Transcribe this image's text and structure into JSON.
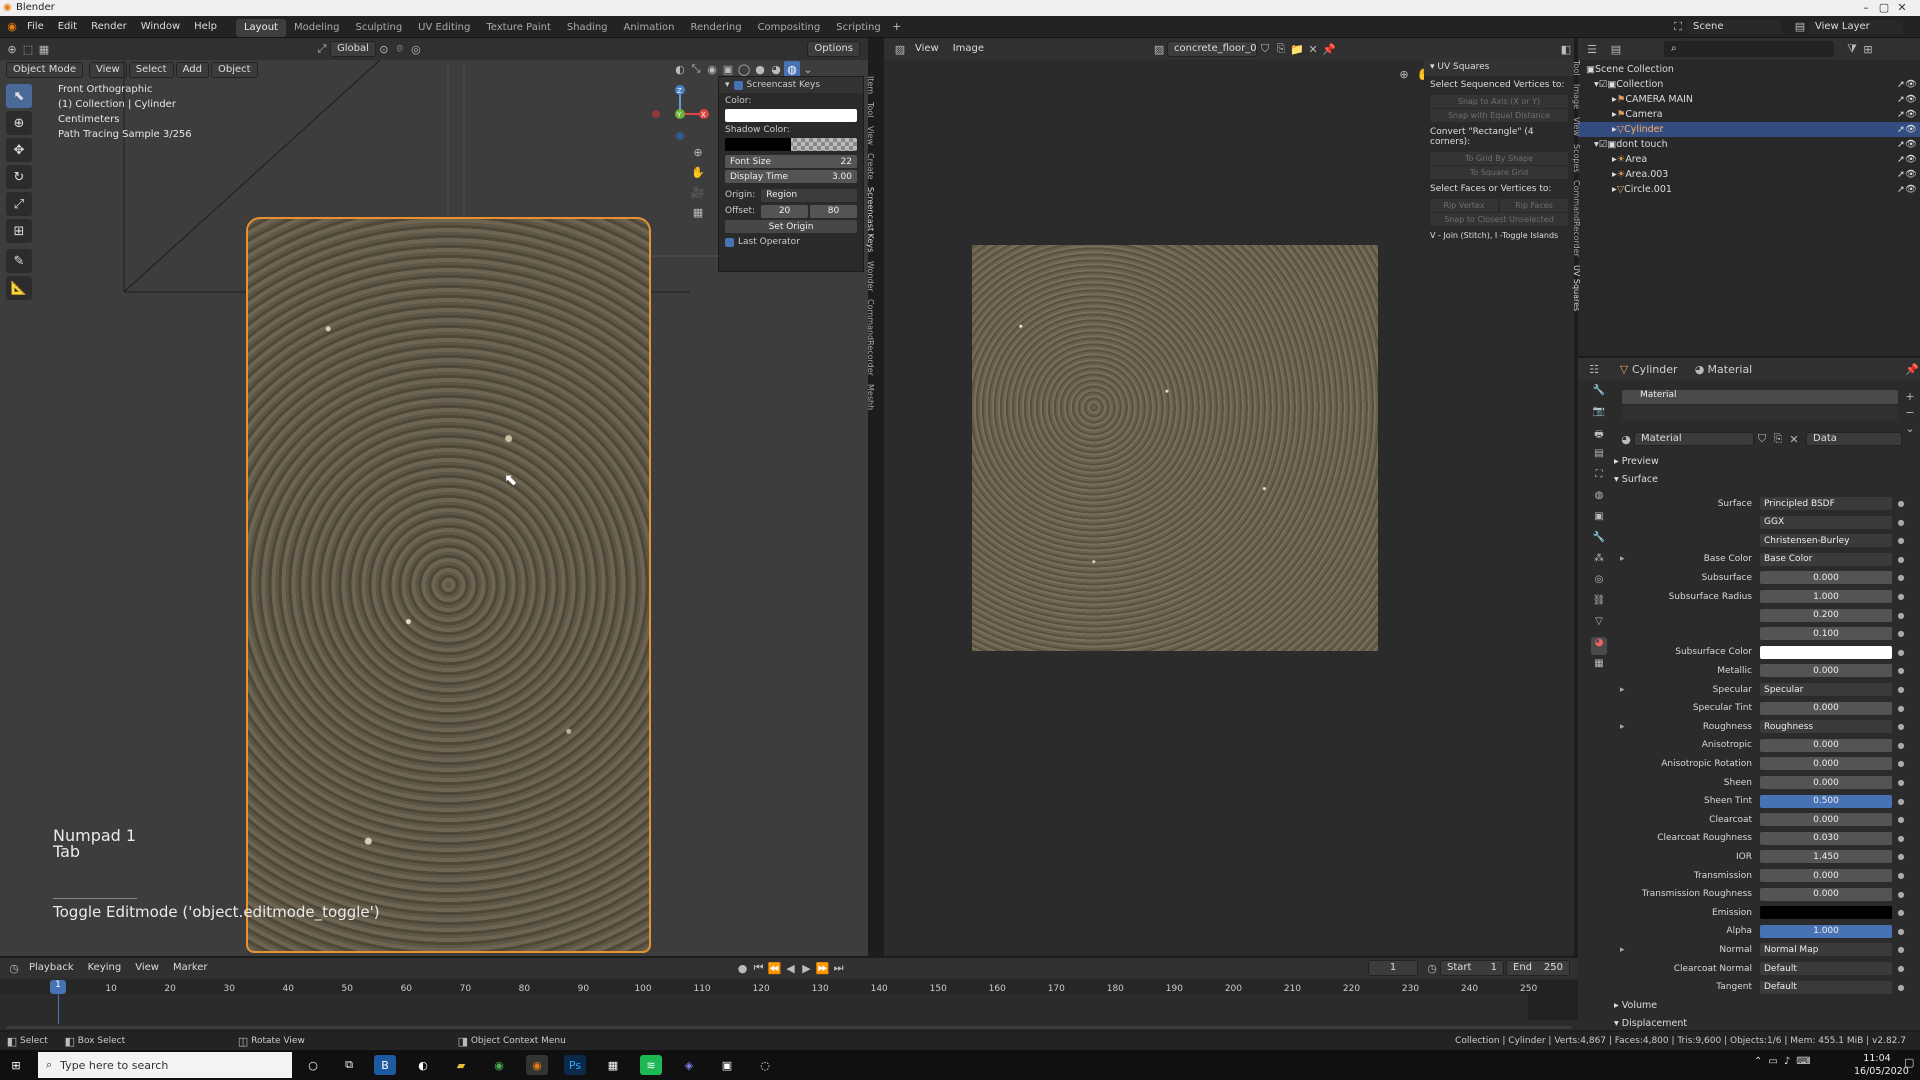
{
  "window": {
    "title": "Blender"
  },
  "menus": [
    "File",
    "Edit",
    "Render",
    "Window",
    "Help"
  ],
  "workspaces": [
    "Layout",
    "Modeling",
    "Sculpting",
    "UV Editing",
    "Texture Paint",
    "Shading",
    "Animation",
    "Rendering",
    "Compositing",
    "Scripting"
  ],
  "active_workspace": "Layout",
  "topbar_right": {
    "scene_label": "Scene",
    "view_layer_label": "View Layer"
  },
  "viewport": {
    "mode": "Object Mode",
    "menus": [
      "View",
      "Select",
      "Add",
      "Object"
    ],
    "transform": "Global",
    "options_label": "Options",
    "info_lines": [
      "Front Orthographic",
      "(1) Collection | Cylinder",
      "Centimeters",
      "Path Tracing Sample 3/256"
    ],
    "key_overlay_1": "Numpad 1",
    "key_overlay_2": "Tab",
    "operator_overlay": "Toggle Editmode ('object.editmode_toggle')"
  },
  "screencast": {
    "title": "Screencast Keys",
    "color_label": "Color:",
    "shadow_label": "Shadow Color:",
    "font_size_label": "Font Size",
    "font_size": "22",
    "display_time_label": "Display Time",
    "display_time": "3.00",
    "origin_label": "Origin:",
    "origin_value": "Region",
    "offset_label": "Offset:",
    "offset_x": "20",
    "offset_y": "80",
    "set_origin": "Set Origin",
    "last_operator": "Last Operator"
  },
  "vertical_tabs": [
    "Item",
    "Tool",
    "View",
    "Create",
    "Screencast Keys",
    "Wonder",
    "CommandRecorder",
    "Meshh"
  ],
  "image_editor": {
    "menus": [
      "View",
      "Image"
    ],
    "image_name": "concrete_floor_01_..."
  },
  "uv_squares": {
    "title": "UV Squares",
    "select_seq": "Select Sequenced Vertices to:",
    "btn1": "Snap to Axis (X or Y)",
    "btn2": "Snap with Equal Distance",
    "convert": "Convert \"Rectangle\" (4 corners):",
    "btn3": "To Grid By Shape",
    "btn4": "To Square Grid",
    "select_faces": "Select Faces or Vertices to:",
    "btn5": "Rip Vertex",
    "btn6": "Rip Faces",
    "btn7": "Snap to Closest Unselected",
    "hint": "V - Join (Stitch), I -Toggle Islands"
  },
  "outliner": {
    "items": [
      {
        "label": "Scene Collection",
        "indent": 0
      },
      {
        "label": "Collection",
        "indent": 1
      },
      {
        "label": "CAMERA MAIN",
        "indent": 2
      },
      {
        "label": "Camera",
        "indent": 2
      },
      {
        "label": "Cylinder",
        "indent": 2
      },
      {
        "label": "dont touch",
        "indent": 1
      },
      {
        "label": "Area",
        "indent": 2
      },
      {
        "label": "Area.003",
        "indent": 2
      },
      {
        "label": "Circle.001",
        "indent": 2
      }
    ]
  },
  "properties": {
    "object": "Cylinder",
    "tab": "Material",
    "slot": "Material",
    "material_name": "Material",
    "data_label": "Data",
    "preview": "Preview",
    "surface": "Surface",
    "volume": "Volume",
    "displacement": "Displacement",
    "rows": [
      {
        "label": "Surface",
        "value": "Principled BSDF",
        "style": "sel"
      },
      {
        "label": "",
        "value": "GGX",
        "style": "sel"
      },
      {
        "label": "",
        "value": "Christensen-Burley",
        "style": "sel"
      },
      {
        "label": "Base Color",
        "value": "Base Color",
        "style": "sel"
      },
      {
        "label": "Subsurface",
        "value": "0.000",
        "style": ""
      },
      {
        "label": "Subsurface Radius",
        "value": "1.000",
        "style": ""
      },
      {
        "label": "",
        "value": "0.200",
        "style": ""
      },
      {
        "label": "",
        "value": "0.100",
        "style": ""
      },
      {
        "label": "Subsurface Color",
        "value": "",
        "style": "white"
      },
      {
        "label": "Metallic",
        "value": "0.000",
        "style": ""
      },
      {
        "label": "Specular",
        "value": "Specular",
        "style": "sel"
      },
      {
        "label": "Specular Tint",
        "value": "0.000",
        "style": ""
      },
      {
        "label": "Roughness",
        "value": "Roughness",
        "style": "sel"
      },
      {
        "label": "Anisotropic",
        "value": "0.000",
        "style": ""
      },
      {
        "label": "Anisotropic Rotation",
        "value": "0.000",
        "style": ""
      },
      {
        "label": "Sheen",
        "value": "0.000",
        "style": ""
      },
      {
        "label": "Sheen Tint",
        "value": "0.500",
        "style": "blue"
      },
      {
        "label": "Clearcoat",
        "value": "0.000",
        "style": ""
      },
      {
        "label": "Clearcoat Roughness",
        "value": "0.030",
        "style": ""
      },
      {
        "label": "IOR",
        "value": "1.450",
        "style": ""
      },
      {
        "label": "Transmission",
        "value": "0.000",
        "style": ""
      },
      {
        "label": "Transmission Roughness",
        "value": "0.000",
        "style": ""
      },
      {
        "label": "Emission",
        "value": "",
        "style": "black"
      },
      {
        "label": "Alpha",
        "value": "1.000",
        "style": "blue"
      },
      {
        "label": "Normal",
        "value": "Normal Map",
        "style": "sel"
      },
      {
        "label": "Clearcoat Normal",
        "value": "Default",
        "style": "sel"
      },
      {
        "label": "Tangent",
        "value": "Default",
        "style": "sel"
      }
    ]
  },
  "timeline": {
    "menus": [
      "Playback",
      "Keying",
      "View",
      "Marker"
    ],
    "current_frame": "1",
    "start_label": "Start",
    "start": "1",
    "end_label": "End",
    "end": "250",
    "ticks": [
      "1",
      "10",
      "20",
      "30",
      "40",
      "50",
      "60",
      "70",
      "80",
      "90",
      "100",
      "110",
      "120",
      "130",
      "140",
      "150",
      "160",
      "170",
      "180",
      "190",
      "200",
      "210",
      "220",
      "230",
      "240",
      "250"
    ]
  },
  "statusbar": {
    "select": "Select",
    "box_select": "Box Select",
    "rotate_view": "Rotate View",
    "context_menu": "Object Context Menu",
    "stats": "Collection | Cylinder | Verts:4,867 | Faces:4,800 | Tris:9,600 | Objects:1/6 | Mem: 455.1 MiB | v2.82.7"
  },
  "taskbar": {
    "search_placeholder": "Type here to search",
    "time": "11:04",
    "date": "16/05/2020"
  },
  "colors": {
    "accent": "#4772b3",
    "selection_outline": "#e8922f",
    "active_row": "#334d80"
  }
}
